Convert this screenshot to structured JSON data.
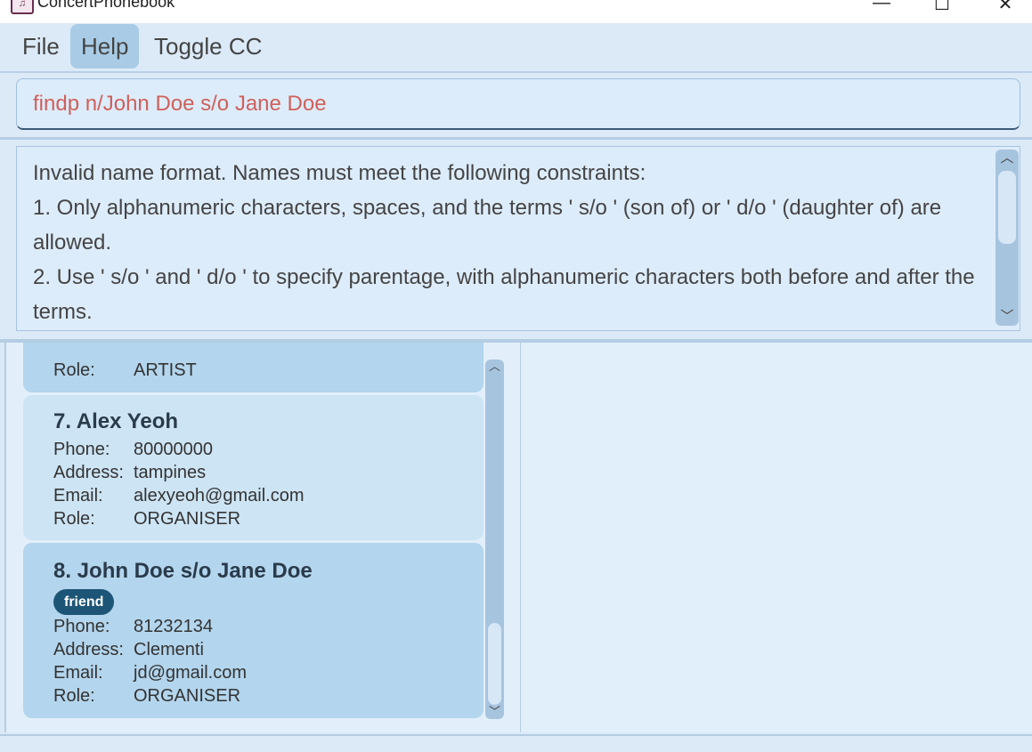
{
  "window": {
    "title": "ConcertPhonebook",
    "icon": "music-notes-icon",
    "minimize": "—",
    "maximize": "☐",
    "close": "✕"
  },
  "menu": {
    "items": [
      {
        "label": "File"
      },
      {
        "label": "Help"
      },
      {
        "label": "Toggle CC"
      }
    ],
    "active_item": "Help"
  },
  "command": {
    "value": "findp n/John Doe s/o Jane Doe",
    "text_color": "#d0605a"
  },
  "result": {
    "lines": [
      "Invalid name format. Names must meet the following constraints:",
      "1. Only alphanumeric characters, spaces, and the terms ' s/o ' (son of) or ' d/o ' (daughter of) are allowed.",
      "2. Use ' s/o ' and ' d/o ' to specify parentage, with alphanumeric characters both before and after the terms."
    ]
  },
  "persons": {
    "partial_card": {
      "role_label": "Role:",
      "role_value": "ARTIST"
    },
    "cards": [
      {
        "name": "7. Alex Yeoh",
        "tags": [],
        "phone_label": "Phone:",
        "phone": "80000000",
        "address_label": "Address:",
        "address": "tampines",
        "email_label": "Email:",
        "email": "alexyeoh@gmail.com",
        "role_label": "Role:",
        "role": "ORGANISER"
      },
      {
        "name": "8. John Doe s/o Jane Doe",
        "tags": [
          "friend"
        ],
        "phone_label": "Phone:",
        "phone": "81232134",
        "address_label": "Address:",
        "address": "Clementi",
        "email_label": "Email:",
        "email": "jd@gmail.com",
        "role_label": "Role:",
        "role": "ORGANISER"
      }
    ]
  },
  "colors": {
    "background": "#dbeaf7",
    "card_even": "#cde4f4",
    "card_odd": "#b3d5ed",
    "tag": "#1d5577",
    "scrollbar": "#a7c4df"
  }
}
